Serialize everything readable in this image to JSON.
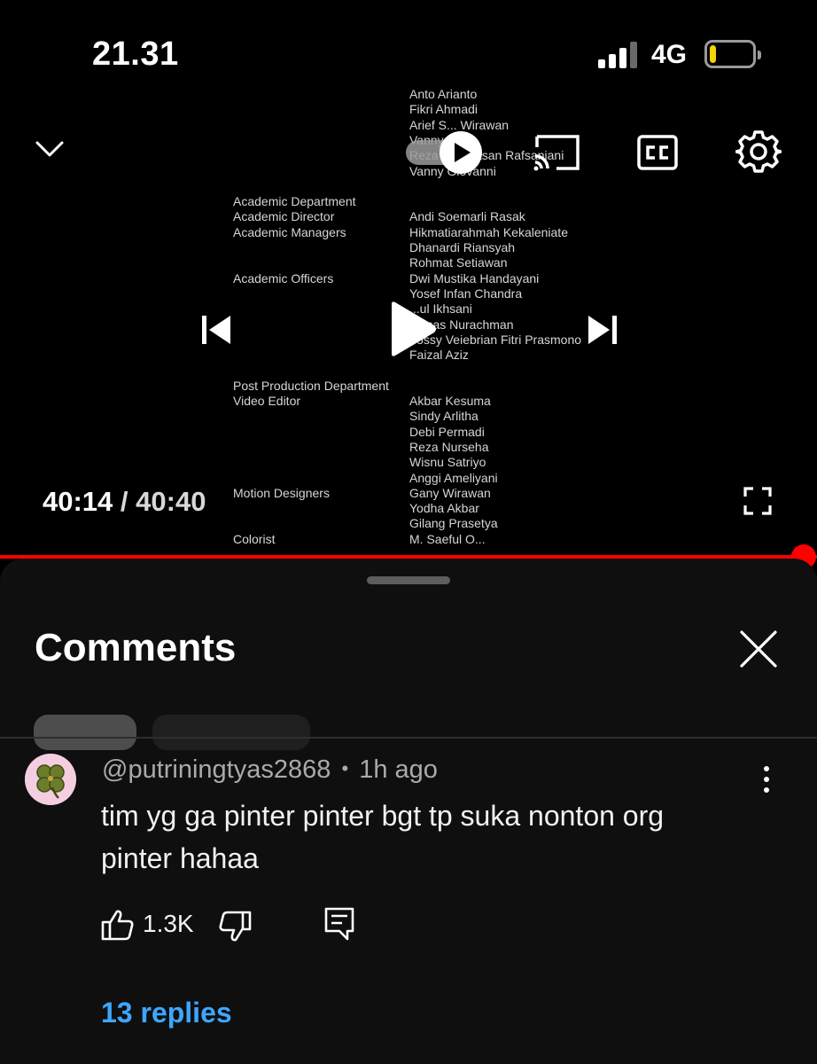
{
  "status_bar": {
    "time": "21.31",
    "network": "4G",
    "battery_level_fraction": 0.15,
    "battery_color": "#f5d400"
  },
  "player": {
    "credits": [
      {
        "left": "",
        "right": "Anto Arianto"
      },
      {
        "left": "",
        "right": "Fikri Ahmadi"
      },
      {
        "left": "",
        "right": "Arief S... Wirawan"
      },
      {
        "left": "",
        "right": "Vanny ...nni"
      },
      {
        "left": "",
        "right": "Reza M... Hasan Rafsanjani"
      },
      {
        "left": "",
        "right": "Vanny Giovanni"
      },
      {
        "left": "",
        "right": ""
      },
      {
        "left": "Academic Department",
        "right": ""
      },
      {
        "left": "Academic Director",
        "right": "Andi Soemarli Rasak"
      },
      {
        "left": "Academic Managers",
        "right": "Hikmatiarahmah Kekaleniate"
      },
      {
        "left": "",
        "right": "Dhanardi Riansyah"
      },
      {
        "left": "",
        "right": "Rohmat Setiawan"
      },
      {
        "left": "Academic Officers",
        "right": "Dwi Mustika Handayani"
      },
      {
        "left": "",
        "right": "Yosef Infan Chandra"
      },
      {
        "left": "",
        "right": "...ul Ikhsani"
      },
      {
        "left": "",
        "right": "...imas Nurachman"
      },
      {
        "left": "",
        "right": "Yossy Veiebrian Fitri Prasmono"
      },
      {
        "left": "",
        "right": "Faizal Aziz"
      },
      {
        "left": "",
        "right": ""
      },
      {
        "left": "Post Production Department",
        "right": ""
      },
      {
        "left": "Video Editor",
        "right": "Akbar Kesuma"
      },
      {
        "left": "",
        "right": "Sindy Arlitha"
      },
      {
        "left": "",
        "right": "Debi Permadi"
      },
      {
        "left": "",
        "right": "Reza Nurseha"
      },
      {
        "left": "",
        "right": "Wisnu Satriyo"
      },
      {
        "left": "",
        "right": "Anggi Ameliyani"
      },
      {
        "left": "Motion Designers",
        "right": "Gany Wirawan"
      },
      {
        "left": "",
        "right": "Yodha Akbar"
      },
      {
        "left": "",
        "right": "Gilang Prasetya"
      },
      {
        "left": "Colorist",
        "right": "M. Saeful O..."
      }
    ],
    "current_time": "40:14",
    "separator": "/",
    "duration": "40:40",
    "progress_fraction": 0.984,
    "progress_color": "#ff0000",
    "icons": [
      "chevron-down-icon",
      "autoplay-toggle-icon",
      "cast-icon",
      "closed-captions-icon",
      "settings-gear-icon",
      "previous-icon",
      "play-icon",
      "next-icon",
      "fullscreen-icon"
    ]
  },
  "comments_panel": {
    "title": "Comments",
    "comment": {
      "author": "@putriningtyas2868",
      "dot": "•",
      "age": "1h ago",
      "text": "tim yg ga pinter pinter bgt tp suka nonton org pinter hahaa",
      "likes": "1.3K",
      "replies_label": "13 replies",
      "replies_color": "#3ea6ff"
    }
  }
}
